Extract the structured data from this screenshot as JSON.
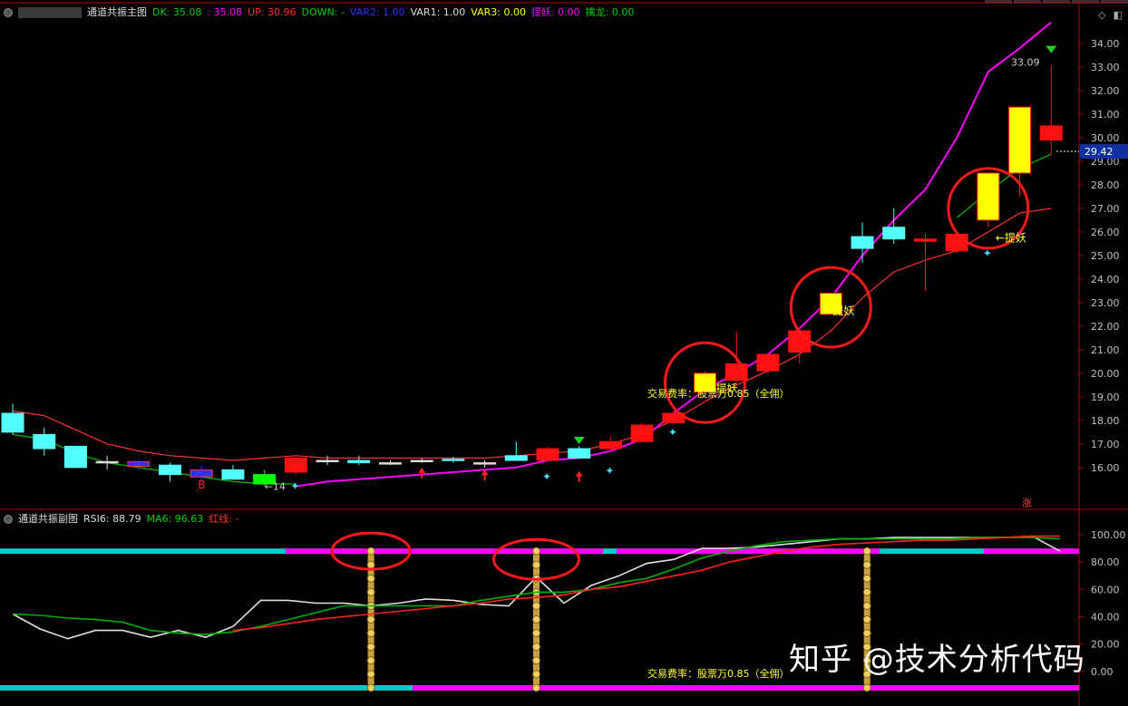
{
  "main_header": {
    "title": "通道共振主图",
    "items": [
      {
        "label": "DK: 35.08",
        "color": "#00d000"
      },
      {
        "label": ": 35.08",
        "color": "#ff00ff"
      },
      {
        "label": "UP: 30.96",
        "color": "#ff3030"
      },
      {
        "label": "DOWN: -",
        "color": "#00d000"
      },
      {
        "label": "VAR2: 1.00",
        "color": "#3030ff"
      },
      {
        "label": "VAR1: 1.00",
        "color": "#dddddd"
      },
      {
        "label": "VAR3: 0.00",
        "color": "#ffff00"
      },
      {
        "label": "提妖: 0.00",
        "color": "#ff00ff"
      },
      {
        "label": "擒龙: 0.00",
        "color": "#00d000"
      }
    ]
  },
  "sub_header": {
    "title": "通道共振副图",
    "items": [
      {
        "label": "RSI6: 88.79",
        "color": "#dddddd"
      },
      {
        "label": "MA6: 96.63",
        "color": "#00d000"
      },
      {
        "label": "红线: -",
        "color": "#ff3030"
      }
    ]
  },
  "watermark": "知乎 @技术分析代码",
  "annotations": {
    "tiyao": "←提妖",
    "fee": "交易费率：股票万0.85（全佣）",
    "fee_main": "交易费率：股票万0.85（全佣）",
    "b_label": "B",
    "low_label": "←14",
    "zhang": "涨",
    "high_label": "33.09"
  },
  "chart_data": [
    {
      "type": "candlestick",
      "title": "通道共振主图",
      "ylim": [
        14.3,
        35.0
      ],
      "yticks": [
        "16.00",
        "17.00",
        "18.00",
        "19.00",
        "20.00",
        "21.00",
        "22.00",
        "23.00",
        "24.00",
        "25.00",
        "26.00",
        "27.00",
        "28.00",
        "29.00",
        "30.00",
        "31.00",
        "32.00",
        "33.00",
        "34.00"
      ],
      "last_price": "29.42",
      "candles": [
        {
          "o": 18.3,
          "c": 17.5,
          "h": 18.7,
          "l": 17.4,
          "color": "cyan"
        },
        {
          "o": 17.4,
          "c": 16.8,
          "h": 17.7,
          "l": 16.5,
          "color": "cyan"
        },
        {
          "o": 16.9,
          "c": 16.0,
          "h": 16.9,
          "l": 16.0,
          "color": "cyan"
        },
        {
          "o": 16.25,
          "c": 16.25,
          "h": 16.5,
          "l": 15.9,
          "color": "cross"
        },
        {
          "o": 16.25,
          "c": 16.05,
          "h": 16.3,
          "l": 15.9,
          "color": "blue"
        },
        {
          "o": 16.1,
          "c": 15.7,
          "h": 16.2,
          "l": 15.4,
          "color": "cyan"
        },
        {
          "o": 15.9,
          "c": 15.6,
          "h": 16.1,
          "l": 15.4,
          "color": "blue"
        },
        {
          "o": 15.9,
          "c": 15.5,
          "h": 16.1,
          "l": 15.5,
          "color": "cyan"
        },
        {
          "o": 15.7,
          "c": 15.3,
          "h": 15.9,
          "l": 15.2,
          "color": "green"
        },
        {
          "o": 15.8,
          "c": 16.4,
          "h": 16.5,
          "l": 15.7,
          "color": "red"
        },
        {
          "o": 16.3,
          "c": 16.3,
          "h": 16.5,
          "l": 16.1,
          "color": "cross"
        },
        {
          "o": 16.2,
          "c": 16.3,
          "h": 16.5,
          "l": 16.1,
          "color": "cyan"
        },
        {
          "o": 16.2,
          "c": 16.2,
          "h": 16.3,
          "l": 16.1,
          "color": "cross"
        },
        {
          "o": 16.3,
          "c": 16.3,
          "h": 16.4,
          "l": 16.2,
          "color": "cross"
        },
        {
          "o": 16.3,
          "c": 16.35,
          "h": 16.45,
          "l": 16.2,
          "color": "cyan"
        },
        {
          "o": 16.2,
          "c": 16.2,
          "h": 16.3,
          "l": 16.0,
          "color": "cross"
        },
        {
          "o": 16.3,
          "c": 16.5,
          "h": 17.1,
          "l": 16.3,
          "color": "cyan"
        },
        {
          "o": 16.3,
          "c": 16.8,
          "h": 16.9,
          "l": 16.3,
          "color": "red"
        },
        {
          "o": 16.4,
          "c": 16.8,
          "h": 16.9,
          "l": 16.4,
          "color": "cyan"
        },
        {
          "o": 16.8,
          "c": 17.1,
          "h": 17.3,
          "l": 16.7,
          "color": "red"
        },
        {
          "o": 17.1,
          "c": 17.8,
          "h": 17.9,
          "l": 17.1,
          "color": "red"
        },
        {
          "o": 17.9,
          "c": 18.3,
          "h": 18.4,
          "l": 17.8,
          "color": "red"
        },
        {
          "o": 19.2,
          "c": 20.0,
          "h": 20.1,
          "l": 19.2,
          "color": "yellow"
        },
        {
          "o": 19.7,
          "c": 20.4,
          "h": 21.8,
          "l": 19.6,
          "color": "red"
        },
        {
          "o": 20.1,
          "c": 20.8,
          "h": 20.8,
          "l": 20.0,
          "color": "red"
        },
        {
          "o": 20.9,
          "c": 21.8,
          "h": 21.9,
          "l": 20.4,
          "color": "red"
        },
        {
          "o": 22.5,
          "c": 23.4,
          "h": 23.4,
          "l": 22.5,
          "color": "yellow"
        },
        {
          "o": 25.8,
          "c": 25.3,
          "h": 26.4,
          "l": 24.7,
          "color": "cyan"
        },
        {
          "o": 26.2,
          "c": 25.7,
          "h": 27.0,
          "l": 25.5,
          "color": "cyan"
        },
        {
          "o": 25.7,
          "c": 25.6,
          "h": 25.9,
          "l": 23.5,
          "color": "red"
        },
        {
          "o": 25.2,
          "c": 25.9,
          "h": 25.9,
          "l": 25.1,
          "color": "red"
        },
        {
          "o": 26.5,
          "c": 28.5,
          "h": 28.5,
          "l": 26.2,
          "color": "yellow"
        },
        {
          "o": 28.5,
          "c": 31.3,
          "h": 31.3,
          "l": 27.5,
          "color": "yellow"
        },
        {
          "o": 29.9,
          "c": 30.5,
          "h": 33.1,
          "l": 29.3,
          "color": "red"
        }
      ],
      "lines": [
        {
          "name": "UP",
          "color": "#ff3030",
          "values": [
            18.4,
            18.2,
            17.6,
            17.0,
            16.7,
            16.5,
            16.4,
            16.3,
            16.4,
            16.5,
            16.4,
            16.4,
            16.4,
            16.4,
            16.4,
            16.4,
            16.5,
            16.6,
            16.7,
            17.0,
            17.4,
            18.0,
            18.8,
            19.5,
            20.1,
            20.8,
            21.8,
            23.2,
            24.3,
            24.8,
            25.2,
            26.0,
            26.8,
            27.0
          ]
        },
        {
          "name": "DOWN",
          "color": "#00c000",
          "values": [
            17.4,
            17.2,
            16.6,
            16.2,
            16.0,
            15.8,
            15.6,
            15.4,
            15.3,
            15.3,
            null,
            null,
            null,
            null,
            null,
            null,
            null,
            null,
            null,
            null,
            null,
            null,
            null,
            null,
            null,
            null,
            null,
            null,
            null,
            null,
            26.6,
            27.7,
            28.7,
            29.3
          ]
        },
        {
          "name": "DK",
          "color": "#ff00ff",
          "values": [
            null,
            null,
            null,
            null,
            null,
            null,
            null,
            null,
            null,
            15.2,
            15.4,
            15.5,
            15.6,
            15.7,
            15.8,
            15.9,
            16.0,
            16.3,
            16.4,
            16.7,
            17.2,
            18.3,
            19.3,
            20.0,
            20.8,
            21.9,
            23.2,
            25.0,
            26.5,
            27.8,
            30.0,
            32.8,
            33.8,
            34.9
          ]
        }
      ]
    },
    {
      "type": "line",
      "title": "通道共振副图",
      "ylim": [
        -18.0,
        108.0
      ],
      "yticks": [
        "0.00",
        "20.00",
        "40.00",
        "60.00",
        "80.00",
        "100.00"
      ],
      "series": [
        {
          "name": "RSI6",
          "color": "#e0e0e0",
          "values": [
            42,
            31,
            24,
            30,
            30,
            25,
            30,
            25,
            33,
            52,
            52,
            50,
            50,
            48,
            50,
            53,
            52,
            49,
            48,
            69,
            50,
            63,
            70,
            79,
            82,
            90,
            90,
            91,
            93,
            95,
            97,
            97,
            98,
            98,
            98,
            98,
            98,
            99,
            88
          ]
        },
        {
          "name": "MA6",
          "color": "#00b000",
          "values": [
            42,
            41,
            39,
            38,
            36,
            30,
            28,
            27,
            29,
            33,
            38,
            43,
            48,
            48,
            48,
            48,
            48,
            52,
            55,
            58,
            58,
            60,
            65,
            68,
            75,
            83,
            88,
            92,
            95,
            96,
            97,
            97,
            97,
            97,
            97,
            98,
            98,
            98,
            97
          ]
        },
        {
          "name": "红线",
          "color": "#ff2020",
          "values": [
            null,
            null,
            null,
            null,
            null,
            null,
            null,
            null,
            30,
            32,
            35,
            38,
            40,
            42,
            44,
            46,
            48,
            50,
            53,
            54,
            56,
            60,
            62,
            66,
            70,
            74,
            80,
            84,
            88,
            91,
            93,
            94,
            95,
            96,
            96,
            97,
            98,
            99,
            99
          ]
        }
      ],
      "bands": [
        {
          "level": 88,
          "colors": "cyan-magenta"
        },
        {
          "level": -12,
          "colors": "cyan-magenta"
        }
      ],
      "signal_columns": [
        13,
        19,
        31
      ]
    }
  ]
}
